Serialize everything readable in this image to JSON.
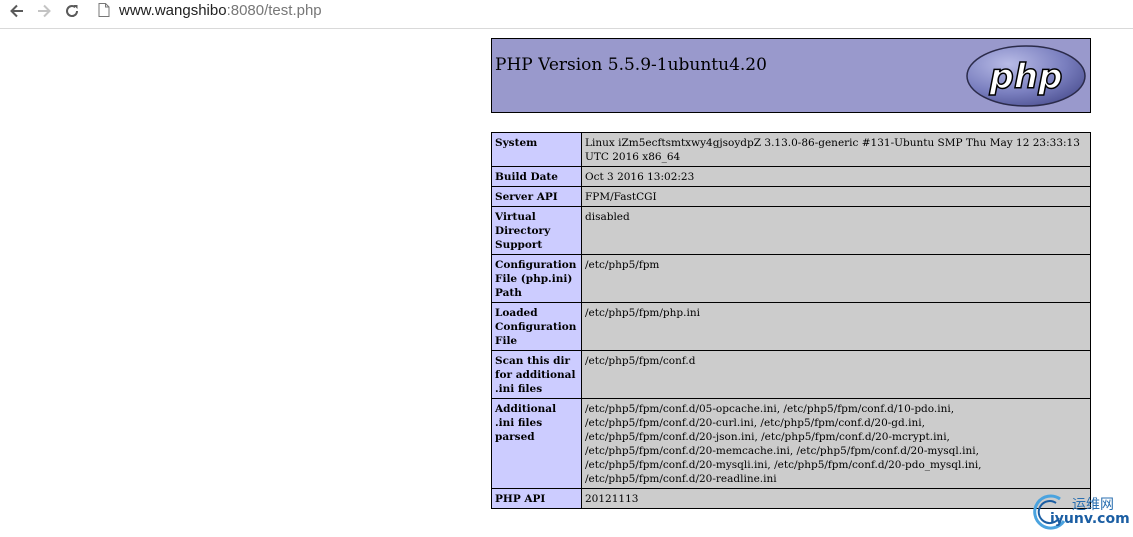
{
  "browser": {
    "url_host": "www.wangshibo",
    "url_rest": ":8080/test.php"
  },
  "phpinfo": {
    "title": "PHP Version 5.5.9-1ubuntu4.20",
    "logo_text": "php",
    "rows": [
      {
        "key": "System",
        "value": "Linux iZm5ecftsmtxwy4gjsoydpZ 3.13.0-86-generic #131-Ubuntu SMP Thu May 12 23:33:13 UTC 2016 x86_64"
      },
      {
        "key": "Build Date",
        "value": "Oct 3 2016 13:02:23"
      },
      {
        "key": "Server API",
        "value": "FPM/FastCGI"
      },
      {
        "key": "Virtual Directory Support",
        "value": "disabled"
      },
      {
        "key": "Configuration File (php.ini) Path",
        "value": "/etc/php5/fpm"
      },
      {
        "key": "Loaded Configuration File",
        "value": "/etc/php5/fpm/php.ini"
      },
      {
        "key": "Scan this dir for additional .ini files",
        "value": "/etc/php5/fpm/conf.d"
      },
      {
        "key": "Additional .ini files parsed",
        "value": "/etc/php5/fpm/conf.d/05-opcache.ini, /etc/php5/fpm/conf.d/10-pdo.ini,\n/etc/php5/fpm/conf.d/20-curl.ini, /etc/php5/fpm/conf.d/20-gd.ini,\n/etc/php5/fpm/conf.d/20-json.ini, /etc/php5/fpm/conf.d/20-mcrypt.ini,\n/etc/php5/fpm/conf.d/20-memcache.ini, /etc/php5/fpm/conf.d/20-mysql.ini,\n/etc/php5/fpm/conf.d/20-mysqli.ini, /etc/php5/fpm/conf.d/20-pdo_mysql.ini,\n/etc/php5/fpm/conf.d/20-readline.ini"
      },
      {
        "key": "PHP API",
        "value": "20121113"
      }
    ]
  },
  "watermark": {
    "cn": "运维网",
    "en": "iyunv.com"
  }
}
